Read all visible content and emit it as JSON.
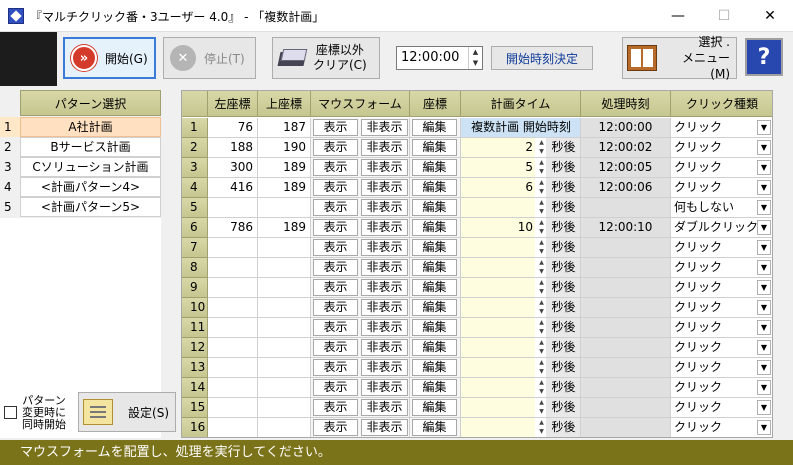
{
  "window": {
    "title": "『マルチクリック番・3ユーザー 4.0』 - 「複数計画」",
    "min": "—",
    "max": "☐",
    "close": "✕"
  },
  "toolbar": {
    "start_label": "開始(G)",
    "stop_label": "停止(T)",
    "clear_label_1": "座標以外",
    "clear_label_2": "クリア(C)",
    "time_value": "12:00:00",
    "decide_label": "開始時刻決定",
    "menu_label_1": "選択 .",
    "menu_label_2": "メニュー(M)",
    "help_label": "?"
  },
  "patterns": {
    "header": "パターン選択",
    "items": [
      {
        "num": "1",
        "name": "A社計画"
      },
      {
        "num": "2",
        "name": "Bサービス計画"
      },
      {
        "num": "3",
        "name": "Cソリューション計画"
      },
      {
        "num": "4",
        "name": "<計画パターン4>"
      },
      {
        "num": "5",
        "name": "<計画パターン5>"
      }
    ]
  },
  "options": {
    "simul_label": "パターン変更時に同時開始",
    "settings_label": "設定(S)"
  },
  "grid": {
    "headers": [
      "左座標",
      "上座標",
      "マウスフォーム",
      "座標",
      "計画タイム",
      "処理時刻",
      "クリック種類"
    ],
    "show_label": "表示",
    "hide_label": "非表示",
    "edit_label": "編集",
    "unit_label": "秒後",
    "first_plan_label": "複数計画 開始時刻",
    "rows": [
      {
        "num": "1",
        "x": "76",
        "y": "187",
        "sec": "",
        "time": "12:00:00",
        "click": "クリック"
      },
      {
        "num": "2",
        "x": "188",
        "y": "190",
        "sec": "2",
        "time": "12:00:02",
        "click": "クリック"
      },
      {
        "num": "3",
        "x": "300",
        "y": "189",
        "sec": "5",
        "time": "12:00:05",
        "click": "クリック"
      },
      {
        "num": "4",
        "x": "416",
        "y": "189",
        "sec": "6",
        "time": "12:00:06",
        "click": "クリック"
      },
      {
        "num": "5",
        "x": "",
        "y": "",
        "sec": "",
        "time": "",
        "click": "何もしない"
      },
      {
        "num": "6",
        "x": "786",
        "y": "189",
        "sec": "10",
        "time": "12:00:10",
        "click": "ダブルクリック"
      },
      {
        "num": "7",
        "x": "",
        "y": "",
        "sec": "",
        "time": "",
        "click": "クリック"
      },
      {
        "num": "8",
        "x": "",
        "y": "",
        "sec": "",
        "time": "",
        "click": "クリック"
      },
      {
        "num": "9",
        "x": "",
        "y": "",
        "sec": "",
        "time": "",
        "click": "クリック"
      },
      {
        "num": "10",
        "x": "",
        "y": "",
        "sec": "",
        "time": "",
        "click": "クリック"
      },
      {
        "num": "11",
        "x": "",
        "y": "",
        "sec": "",
        "time": "",
        "click": "クリック"
      },
      {
        "num": "12",
        "x": "",
        "y": "",
        "sec": "",
        "time": "",
        "click": "クリック"
      },
      {
        "num": "13",
        "x": "",
        "y": "",
        "sec": "",
        "time": "",
        "click": "クリック"
      },
      {
        "num": "14",
        "x": "",
        "y": "",
        "sec": "",
        "time": "",
        "click": "クリック"
      },
      {
        "num": "15",
        "x": "",
        "y": "",
        "sec": "",
        "time": "",
        "click": "クリック"
      },
      {
        "num": "16",
        "x": "",
        "y": "",
        "sec": "",
        "time": "",
        "click": "クリック"
      }
    ]
  },
  "status": "マウスフォームを配置し、処理を実行してください。"
}
